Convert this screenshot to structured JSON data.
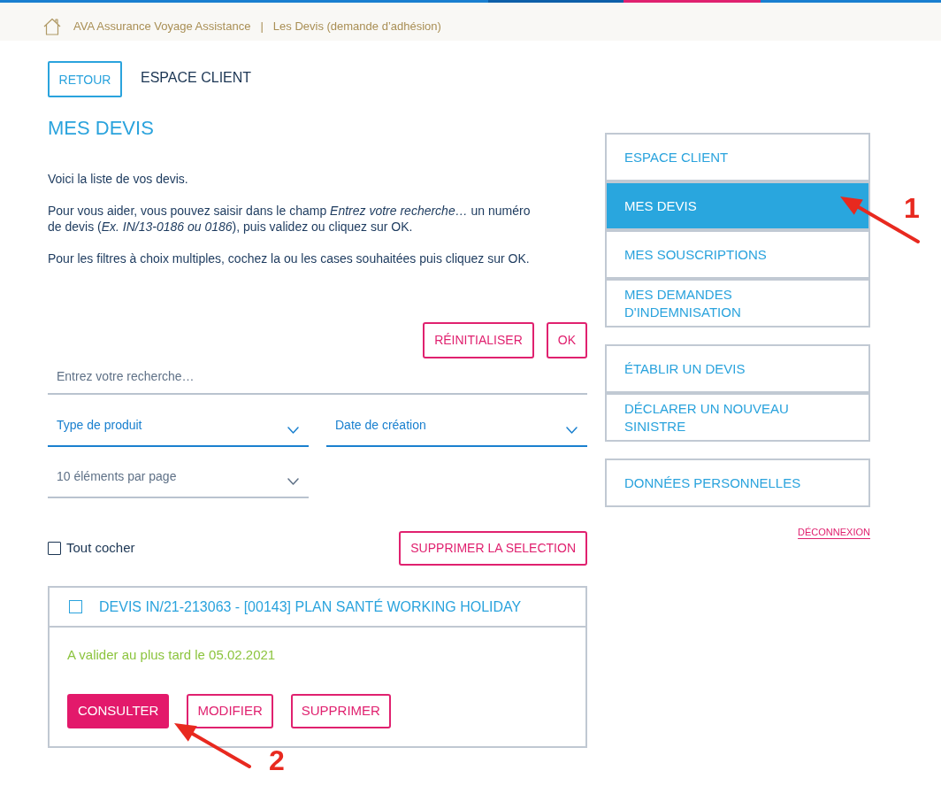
{
  "breadcrumb": {
    "items": [
      "AVA Assurance Voyage Assistance",
      "Les Devis (demande d’adhésion)"
    ],
    "separator": "|"
  },
  "header": {
    "back_button": "RETOUR",
    "title": "ESPACE CLIENT"
  },
  "page_title": "MES DEVIS",
  "intro": [
    "Voici la liste de vos devis.",
    "Pour vous aider, vous pouvez saisir dans le champ *Entrez votre recherche…* un numéro de devis (*Ex. IN/13-0186 ou 0186*), puis validez ou cliquez sur OK.",
    "Pour les filtres à choix multiples, cochez la ou les cases souhaitées puis cliquez sur OK."
  ],
  "filter_buttons": [
    "RÉINITIALISER",
    "OK"
  ],
  "search": {
    "placeholder": "Entrez votre recherche…"
  },
  "filters": [
    {
      "label": "Type de produit",
      "active": true
    },
    {
      "label": "Date de création",
      "active": true
    },
    {
      "label": "10 éléments par page",
      "active": false
    }
  ],
  "select_all": {
    "label": "Tout cocher",
    "checked": false
  },
  "delete_selection_button": "SUPPRIMER LA SELECTION",
  "quotes": [
    {
      "checked": false,
      "title": "DEVIS IN/21-213063 - [00143] PLAN SANTÉ WORKING HOLIDAY",
      "deadline": "A valider au plus tard le 05.02.2021",
      "actions": [
        {
          "label": "CONSULTER",
          "primary": true
        },
        {
          "label": "MODIFIER",
          "primary": false
        },
        {
          "label": "SUPPRIMER",
          "primary": false
        }
      ]
    }
  ],
  "sidebar": {
    "groups": [
      {
        "items": [
          {
            "label": "ESPACE CLIENT",
            "selected": false
          },
          {
            "label": "MES DEVIS",
            "selected": true
          },
          {
            "label": "MES SOUSCRIPTIONS",
            "selected": false
          },
          {
            "label": "MES DEMANDES D'INDEMNISATION",
            "selected": false
          }
        ]
      },
      {
        "items": [
          {
            "label": "ÉTABLIR UN DEVIS",
            "selected": false
          },
          {
            "label": "DÉCLARER UN NOUVEAU SINISTRE",
            "selected": false
          }
        ]
      },
      {
        "items": [
          {
            "label": "DONNÉES PERSONNELLES",
            "selected": false
          }
        ]
      }
    ],
    "logout": "DÉCONNEXION"
  },
  "annotations": [
    {
      "number": "1"
    },
    {
      "number": "2"
    }
  ]
}
